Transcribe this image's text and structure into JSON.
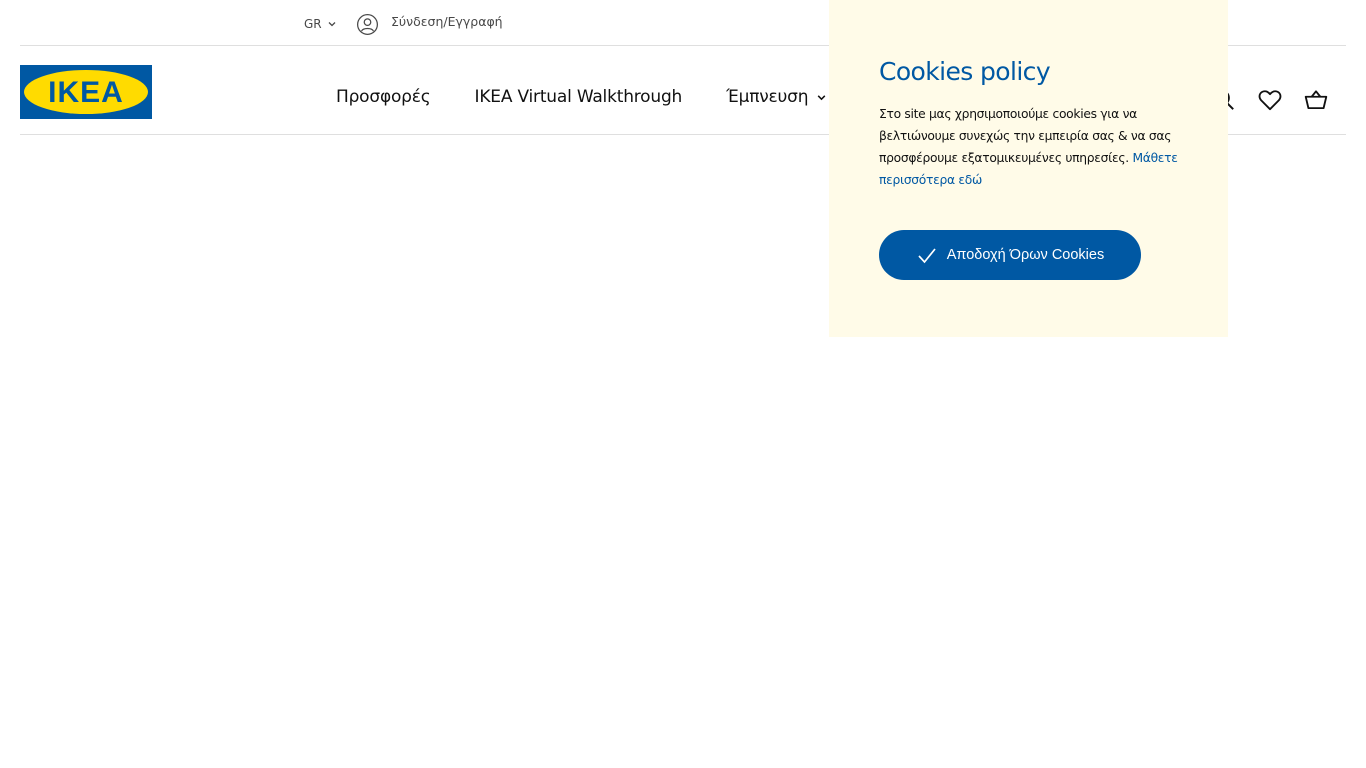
{
  "topbar": {
    "language": "GR",
    "login_label": "Σύνδεση/Εγγραφή"
  },
  "header": {
    "logo_text": "IKEA",
    "nav": [
      {
        "label": "Προσφορές"
      },
      {
        "label": "IKEA Virtual Walkthrough"
      },
      {
        "label": "Έμπνευση"
      }
    ],
    "icons": [
      "search-icon",
      "heart-icon",
      "basket-icon"
    ]
  },
  "cookie_banner": {
    "title": "Cookies policy",
    "body": "Στο site μας χρησιμοποιούμε cookies για να βελτιώνουμε συνεχώς την εμπειρία σας & να σας προσφέρουμε εξατομικευμένες υπηρεσίες. ",
    "learn_more": "Μάθετε περισσότερα εδώ",
    "accept_label": "Αποδοχή Όρων Cookies"
  },
  "colors": {
    "brand_blue": "#0058a3",
    "brand_yellow": "#ffdb00",
    "banner_bg": "#fffbe8"
  }
}
